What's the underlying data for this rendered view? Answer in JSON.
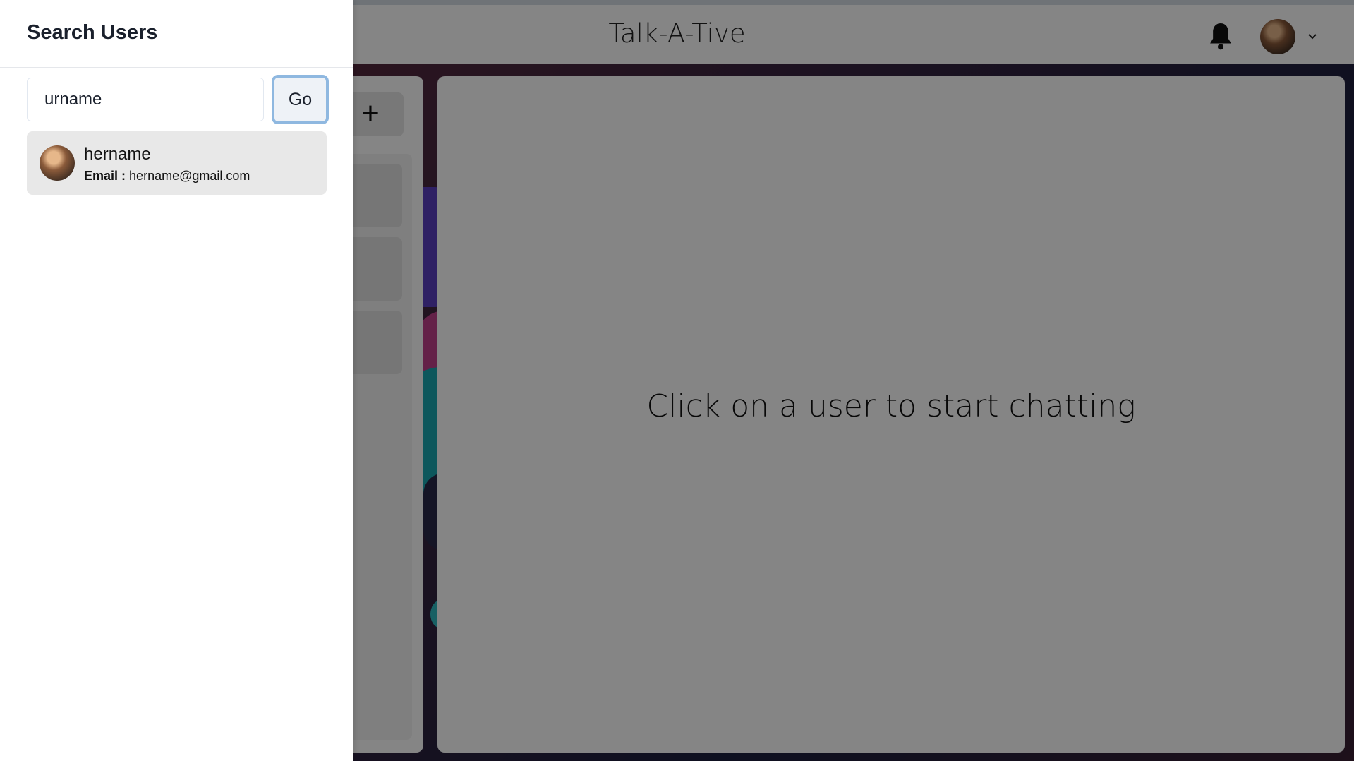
{
  "app": {
    "title": "Talk-A-Tive"
  },
  "header": {
    "bell_icon": "bell-icon",
    "menu_icon": "chevron-down-icon"
  },
  "chats": {
    "new_group_button_icon": "+"
  },
  "chatbox": {
    "empty_hint": "Click on a user to start chatting"
  },
  "drawer": {
    "title": "Search Users",
    "search": {
      "value": "urname",
      "placeholder": "Search by name or email"
    },
    "go_label": "Go",
    "results": [
      {
        "name": "hername",
        "email_label": "Email :",
        "email": "hername@gmail.com"
      }
    ]
  },
  "colors": {
    "overlay": "#00000080",
    "go_focus_ring": "#8fb8e0"
  }
}
